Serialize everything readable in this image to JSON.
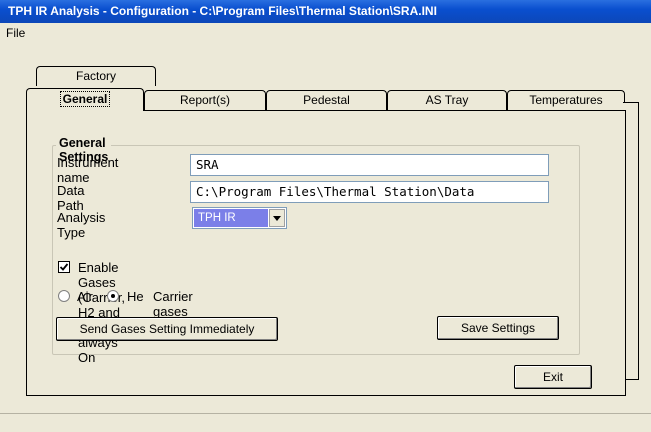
{
  "window": {
    "title": "TPH IR Analysis - Configuration - C:\\Program Files\\Thermal Station\\SRA.INI"
  },
  "menu": {
    "file": "File"
  },
  "tabs": {
    "factory": "Factory",
    "general": "General",
    "reports": "Report(s)",
    "pedestal": "Pedestal",
    "as_tray": "AS Tray",
    "temperatures": "Temperatures"
  },
  "general_settings": {
    "title": "General Settings",
    "instrument_name_label": "Instrument name",
    "instrument_name_value": "SRA",
    "data_path_label": "Data Path",
    "data_path_value": "C:\\Program Files\\Thermal Station\\Data",
    "analysis_type_label": "Analysis Type",
    "analysis_type_value": "TPH IR",
    "enable_gases_label": "Enable Gases (Carrier, H2 and Air) always On",
    "enable_gases_checked": true,
    "radio_air_label": "Air",
    "radio_he_label": "He",
    "carrier_gases_label": "Carrier gases",
    "carrier_selected": "He"
  },
  "buttons": {
    "send_gases": "Send Gases Setting Immediately",
    "save_settings": "Save Settings",
    "exit": "Exit"
  },
  "colors": {
    "title_bar": "#0c4fcf",
    "combo_highlight": "#7b7fe8",
    "background": "#ece9d8"
  }
}
